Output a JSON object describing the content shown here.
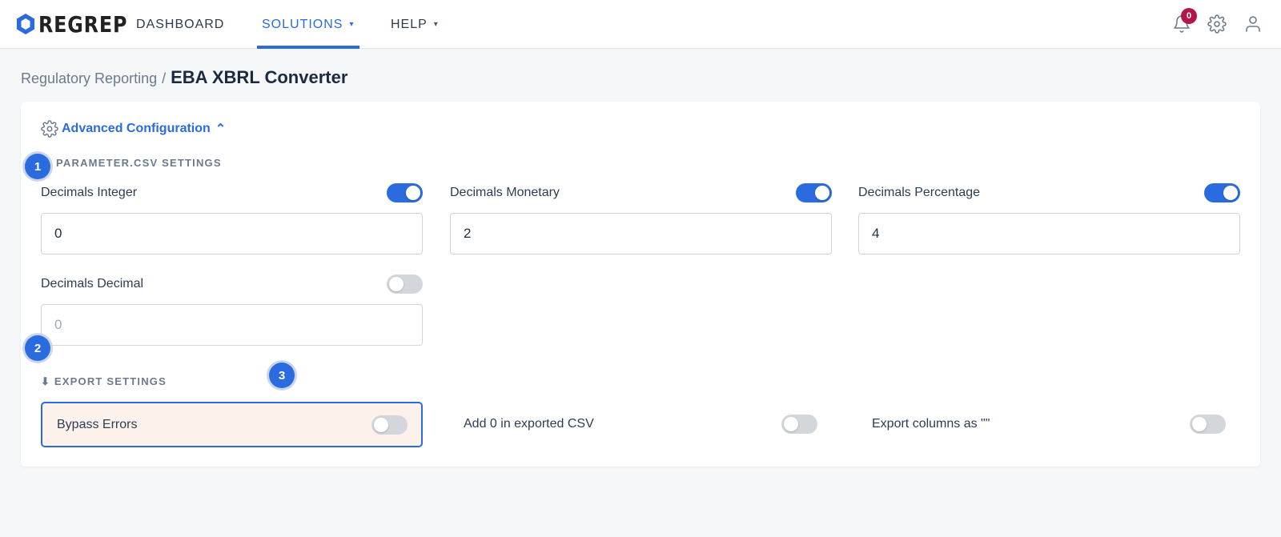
{
  "header": {
    "logo_text": "REGREP",
    "nav": [
      {
        "label": "DASHBOARD"
      },
      {
        "label": "SOLUTIONS",
        "caret": "▾"
      },
      {
        "label": "HELP",
        "caret": "▾"
      }
    ],
    "notifications_count": "0"
  },
  "breadcrumb": {
    "parent": "Regulatory Reporting",
    "separator": "/",
    "current": "EBA XBRL Converter"
  },
  "advanced": {
    "label": "Advanced Configuration",
    "chevron": "⌃"
  },
  "parameter_section": {
    "title": "PARAMETER.CSV SETTINGS",
    "fields": [
      {
        "label": "Decimals Integer",
        "value": "0",
        "enabled": true
      },
      {
        "label": "Decimals Monetary",
        "value": "2",
        "enabled": true
      },
      {
        "label": "Decimals Percentage",
        "value": "4",
        "enabled": true
      },
      {
        "label": "Decimals Decimal",
        "value": "0",
        "enabled": false
      }
    ]
  },
  "export_section": {
    "title": "⬇ EXPORT SETTINGS",
    "options": [
      {
        "label": "Bypass Errors",
        "enabled": false
      },
      {
        "label": "Add 0 in exported CSV",
        "enabled": false
      },
      {
        "label": "Export columns as \"\"",
        "enabled": false
      }
    ]
  },
  "markers": [
    "1",
    "2",
    "3"
  ],
  "colors": {
    "accent": "#2a6be0",
    "badge": "#b3174a",
    "highlight_bg": "#fdf1ec"
  }
}
